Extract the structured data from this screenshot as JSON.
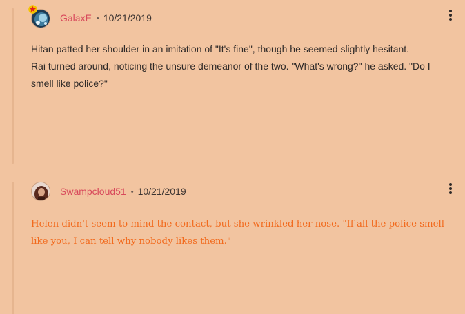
{
  "comments": [
    {
      "author": "GalaxE",
      "separator": "•",
      "date": "10/21/2019",
      "avatar_icon": "galaxy-avatar",
      "badge_icon": "star-badge-icon",
      "lines": [
        "Hitan patted her shoulder in an imitation of \"It's fine\", though he seemed slightly hesitant.",
        "Rai turned around, noticing the unsure demeanor of the two. \"What's wrong?\" he asked. \"Do I smell like police?\""
      ]
    },
    {
      "author": "Swampcloud51",
      "separator": "•",
      "date": "10/21/2019",
      "avatar_icon": "portrait-avatar",
      "lines": [
        "Helen didn't seem to mind the contact, but she wrinkled her nose. \"If all the police smell like you, I can tell why nobody likes them.\""
      ],
      "text_color": "#f26a1d"
    }
  ],
  "colors": {
    "background": "#f2c4a0",
    "author": "#d8495b",
    "thread_line": "#e6b58f"
  }
}
